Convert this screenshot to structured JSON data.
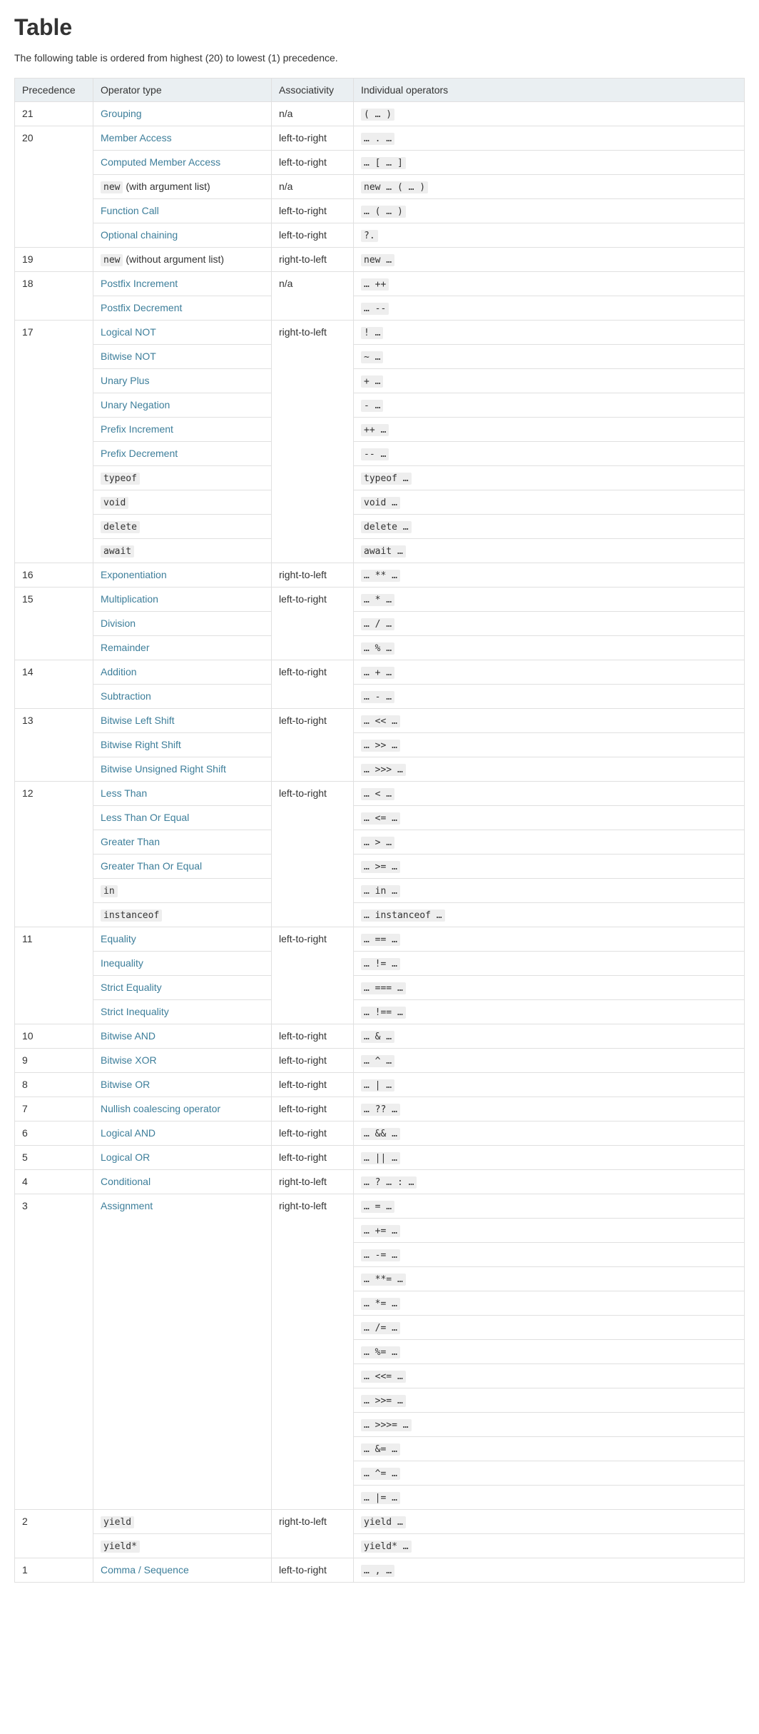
{
  "heading": "Table",
  "intro": "The following table is ordered from highest (20) to lowest (1) precedence.",
  "columns": [
    "Precedence",
    "Operator type",
    "Associativity",
    "Individual operators"
  ],
  "entries": [
    {
      "prec": "21",
      "label": "Grouping",
      "link": true,
      "codeLabel": false,
      "assoc": "n/a",
      "ops": [
        "( … )"
      ]
    },
    {
      "prec": "20",
      "label": "Member Access",
      "link": true,
      "codeLabel": false,
      "assoc": "left-to-right",
      "ops": [
        "… . …"
      ]
    },
    {
      "label": "Computed Member Access",
      "link": true,
      "codeLabel": false,
      "assoc": "left-to-right",
      "ops": [
        "… [ … ]"
      ]
    },
    {
      "label": "new",
      "link": true,
      "codeLabel": true,
      "suffix": " (with argument list)",
      "assoc": "n/a",
      "ops": [
        "new … ( … )"
      ]
    },
    {
      "label": "Function Call",
      "link": true,
      "codeLabel": false,
      "assoc": "left-to-right",
      "ops": [
        "… ( … )"
      ]
    },
    {
      "label": "Optional chaining",
      "link": true,
      "codeLabel": false,
      "assoc": "left-to-right",
      "ops": [
        "?."
      ]
    },
    {
      "prec": "19",
      "label": "new",
      "link": true,
      "codeLabel": true,
      "suffix": " (without argument list)",
      "assoc": "right-to-left",
      "ops": [
        "new …"
      ]
    },
    {
      "prec": "18",
      "label": "Postfix Increment",
      "link": true,
      "codeLabel": false,
      "assoc": "n/a",
      "assocSpan": 2,
      "ops": [
        "… ++"
      ]
    },
    {
      "label": "Postfix Decrement",
      "link": true,
      "codeLabel": false,
      "ops": [
        "… --"
      ]
    },
    {
      "prec": "17",
      "label": "Logical NOT",
      "link": true,
      "codeLabel": false,
      "assoc": "right-to-left",
      "assocSpan": 10,
      "ops": [
        "! …"
      ]
    },
    {
      "label": "Bitwise NOT",
      "link": true,
      "codeLabel": false,
      "ops": [
        "~ …"
      ]
    },
    {
      "label": "Unary Plus",
      "link": true,
      "codeLabel": false,
      "ops": [
        "+ …"
      ]
    },
    {
      "label": "Unary Negation",
      "link": true,
      "codeLabel": false,
      "ops": [
        "- …"
      ]
    },
    {
      "label": "Prefix Increment",
      "link": true,
      "codeLabel": false,
      "ops": [
        "++ …"
      ]
    },
    {
      "label": "Prefix Decrement",
      "link": true,
      "codeLabel": false,
      "ops": [
        "-- …"
      ]
    },
    {
      "label": "typeof",
      "link": true,
      "codeLabel": true,
      "ops": [
        "typeof …"
      ]
    },
    {
      "label": "void",
      "link": true,
      "codeLabel": true,
      "ops": [
        "void …"
      ]
    },
    {
      "label": "delete",
      "link": true,
      "codeLabel": true,
      "ops": [
        "delete …"
      ]
    },
    {
      "label": "await",
      "link": true,
      "codeLabel": true,
      "ops": [
        "await …"
      ]
    },
    {
      "prec": "16",
      "label": "Exponentiation",
      "link": true,
      "codeLabel": false,
      "assoc": "right-to-left",
      "ops": [
        "… ** …"
      ]
    },
    {
      "prec": "15",
      "label": "Multiplication",
      "link": true,
      "codeLabel": false,
      "assoc": "left-to-right",
      "assocSpan": 3,
      "ops": [
        "… * …"
      ]
    },
    {
      "label": "Division",
      "link": true,
      "codeLabel": false,
      "ops": [
        "… / …"
      ]
    },
    {
      "label": "Remainder",
      "link": true,
      "codeLabel": false,
      "ops": [
        "… % …"
      ]
    },
    {
      "prec": "14",
      "label": "Addition",
      "link": true,
      "codeLabel": false,
      "assoc": "left-to-right",
      "assocSpan": 2,
      "ops": [
        "… + …"
      ]
    },
    {
      "label": "Subtraction",
      "link": true,
      "codeLabel": false,
      "ops": [
        "… - …"
      ]
    },
    {
      "prec": "13",
      "label": "Bitwise Left Shift",
      "link": true,
      "codeLabel": false,
      "assoc": "left-to-right",
      "assocSpan": 3,
      "ops": [
        "… << …"
      ]
    },
    {
      "label": "Bitwise Right Shift",
      "link": true,
      "codeLabel": false,
      "ops": [
        "… >> …"
      ]
    },
    {
      "label": "Bitwise Unsigned Right Shift",
      "link": true,
      "codeLabel": false,
      "ops": [
        "… >>> …"
      ]
    },
    {
      "prec": "12",
      "label": "Less Than",
      "link": true,
      "codeLabel": false,
      "assoc": "left-to-right",
      "assocSpan": 6,
      "ops": [
        "… < …"
      ]
    },
    {
      "label": "Less Than Or Equal",
      "link": true,
      "codeLabel": false,
      "ops": [
        "… <= …"
      ]
    },
    {
      "label": "Greater Than",
      "link": true,
      "codeLabel": false,
      "ops": [
        "… > …"
      ]
    },
    {
      "label": "Greater Than Or Equal",
      "link": true,
      "codeLabel": false,
      "ops": [
        "… >= …"
      ]
    },
    {
      "label": "in",
      "link": true,
      "codeLabel": true,
      "ops": [
        "… in …"
      ]
    },
    {
      "label": "instanceof",
      "link": true,
      "codeLabel": true,
      "ops": [
        "… instanceof …"
      ]
    },
    {
      "prec": "11",
      "label": "Equality",
      "link": true,
      "codeLabel": false,
      "assoc": "left-to-right",
      "assocSpan": 4,
      "ops": [
        "… == …"
      ]
    },
    {
      "label": "Inequality",
      "link": true,
      "codeLabel": false,
      "ops": [
        "… != …"
      ]
    },
    {
      "label": "Strict Equality",
      "link": true,
      "codeLabel": false,
      "ops": [
        "… === …"
      ]
    },
    {
      "label": "Strict Inequality",
      "link": true,
      "codeLabel": false,
      "ops": [
        "… !== …"
      ]
    },
    {
      "prec": "10",
      "label": "Bitwise AND",
      "link": true,
      "codeLabel": false,
      "assoc": "left-to-right",
      "ops": [
        "… & …"
      ]
    },
    {
      "prec": "9",
      "label": "Bitwise XOR",
      "link": true,
      "codeLabel": false,
      "assoc": "left-to-right",
      "ops": [
        "… ^ …"
      ]
    },
    {
      "prec": "8",
      "label": "Bitwise OR",
      "link": true,
      "codeLabel": false,
      "assoc": "left-to-right",
      "ops": [
        "… | …"
      ]
    },
    {
      "prec": "7",
      "label": "Nullish coalescing operator",
      "link": true,
      "codeLabel": false,
      "assoc": "left-to-right",
      "ops": [
        "… ?? …"
      ]
    },
    {
      "prec": "6",
      "label": "Logical AND",
      "link": true,
      "codeLabel": false,
      "assoc": "left-to-right",
      "ops": [
        "… && …"
      ]
    },
    {
      "prec": "5",
      "label": "Logical OR",
      "link": true,
      "codeLabel": false,
      "assoc": "left-to-right",
      "ops": [
        "… || …"
      ]
    },
    {
      "prec": "4",
      "label": "Conditional",
      "link": true,
      "codeLabel": false,
      "assoc": "right-to-left",
      "ops": [
        "… ? … : …"
      ]
    },
    {
      "prec": "3",
      "label": "Assignment",
      "link": true,
      "codeLabel": false,
      "assoc": "right-to-left",
      "ops": [
        "… = …",
        "… += …",
        "… -= …",
        "… **= …",
        "… *= …",
        "… /= …",
        "… %= …",
        "… <<= …",
        "… >>= …",
        "… >>>= …",
        "… &= …",
        "… ^= …",
        "… |= …"
      ]
    },
    {
      "prec": "2",
      "label": "yield",
      "link": true,
      "codeLabel": true,
      "assoc": "right-to-left",
      "assocSpan": 2,
      "ops": [
        "yield …"
      ]
    },
    {
      "label": "yield*",
      "link": true,
      "codeLabel": true,
      "ops": [
        "yield* …"
      ]
    },
    {
      "prec": "1",
      "label": "Comma / Sequence",
      "link": true,
      "codeLabel": false,
      "assoc": "left-to-right",
      "ops": [
        "… , …"
      ]
    }
  ]
}
